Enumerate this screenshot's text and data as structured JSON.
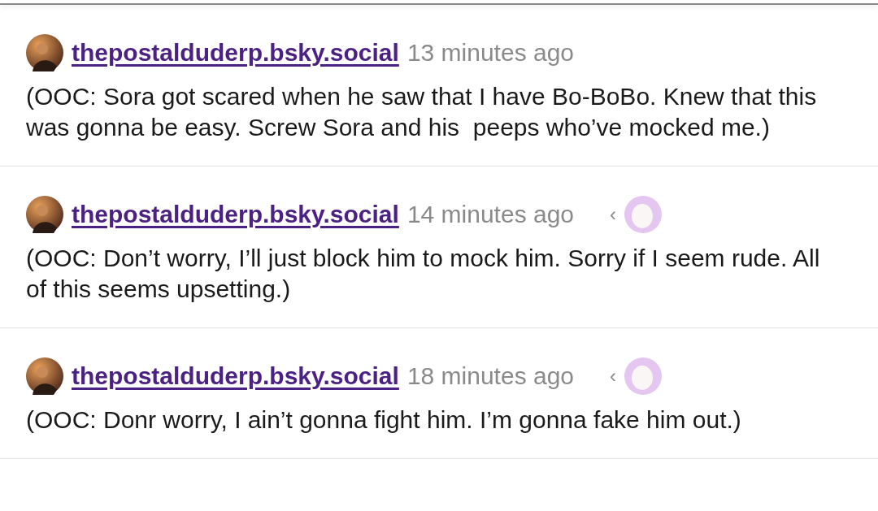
{
  "comments": [
    {
      "user": "thepostalduderp.bsky.social",
      "time": "13 minutes ago",
      "text": "(OOC: Sora got scared when he saw that I have Bo-BoBo. Knew that this was gonna be easy. Screw Sora and his  peeps who’ve mocked me.)"
    },
    {
      "user": "thepostalduderp.bsky.social",
      "time": "14 minutes ago",
      "reply_marker": "‹",
      "text": "(OOC: Don’t worry, I’ll just block him to mock him. Sorry if I seem rude. All of this seems upsetting.)"
    },
    {
      "user": "thepostalduderp.bsky.social",
      "time": "18 minutes ago",
      "reply_marker": "‹",
      "text": "(OOC: Donr worry, I ain’t gonna fight him. I’m gonna fake him out.)"
    }
  ]
}
